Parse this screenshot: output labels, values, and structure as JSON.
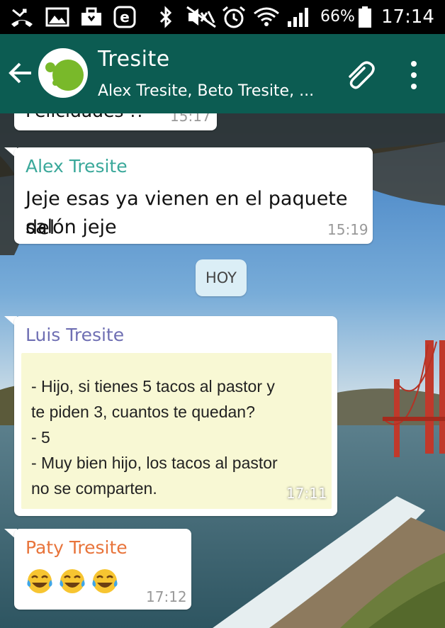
{
  "status_bar": {
    "battery_percent": "66%",
    "time": "17:14",
    "icons": [
      "missed-call-icon",
      "image-icon",
      "briefcase-icon",
      "e-icon",
      "bluetooth-icon",
      "mute-icon",
      "alarm-icon",
      "wifi-icon",
      "signal-icon",
      "battery-icon"
    ]
  },
  "header": {
    "title": "Tresite",
    "subtitle": "Alex Tresite, Beto Tresite, ...",
    "icons": [
      "back-arrow-icon",
      "group-avatar",
      "paperclip-icon",
      "overflow-menu-icon"
    ],
    "color": "#0c5c52"
  },
  "chat": {
    "partial_message": {
      "text": "Felicidades !!",
      "time": "15:17"
    },
    "messages": [
      {
        "sender": "Alex Tresite",
        "sender_color": "#3aa89a",
        "lines": [
          "Jeje esas ya vienen en el paquete del",
          "salón jeje"
        ],
        "time": "15:19"
      },
      {
        "sender": "Luis Tresite",
        "sender_color": "#6f6fb3",
        "image_lines": [
          "- Hijo, si tienes 5 tacos al pastor y",
          "te piden 3, cuantos te quedan?",
          "- 5",
          "- Muy bien hijo, los tacos al pastor",
          "no se comparten."
        ],
        "time": "17:11"
      },
      {
        "sender": "Paty Tresite",
        "sender_color": "#e8743b",
        "emoji": [
          "face-with-tears-of-joy",
          "face-with-tears-of-joy",
          "face-with-tears-of-joy"
        ],
        "time": "17:12"
      }
    ],
    "day_separator": "HOY"
  }
}
